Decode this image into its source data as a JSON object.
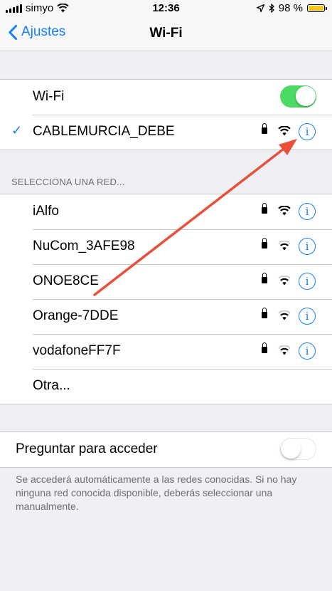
{
  "status_bar": {
    "carrier": "simyo",
    "time": "12:36",
    "battery_percent": "98 %",
    "battery_level": 0.98,
    "battery_color": "#f5c526"
  },
  "nav": {
    "back_label": "Ajustes",
    "title": "Wi-Fi"
  },
  "wifi_group": {
    "wifi_label": "Wi-Fi",
    "wifi_enabled": true,
    "connected_network": "CABLEMURCIA_DEBE"
  },
  "networks_header": "SELECCIONA UNA RED...",
  "networks": [
    {
      "name": "iAlfo",
      "locked": true
    },
    {
      "name": "NuCom_3AFE98",
      "locked": true
    },
    {
      "name": "ONOE8CE",
      "locked": true
    },
    {
      "name": "Orange-7DDE",
      "locked": true
    },
    {
      "name": "vodafoneFF7F",
      "locked": true
    }
  ],
  "other_label": "Otra...",
  "ask_to_join": {
    "label": "Preguntar para acceder",
    "enabled": false,
    "footer": "Se accederá automáticamente a las redes conocidas. Si no hay ninguna red conocida disponible, deberás seleccionar una manualmente."
  },
  "colors": {
    "accent": "#157efb",
    "toggle_on": "#4cd964",
    "arrow": "#e8503a"
  },
  "icons": {
    "info": "i",
    "check": "✓"
  }
}
